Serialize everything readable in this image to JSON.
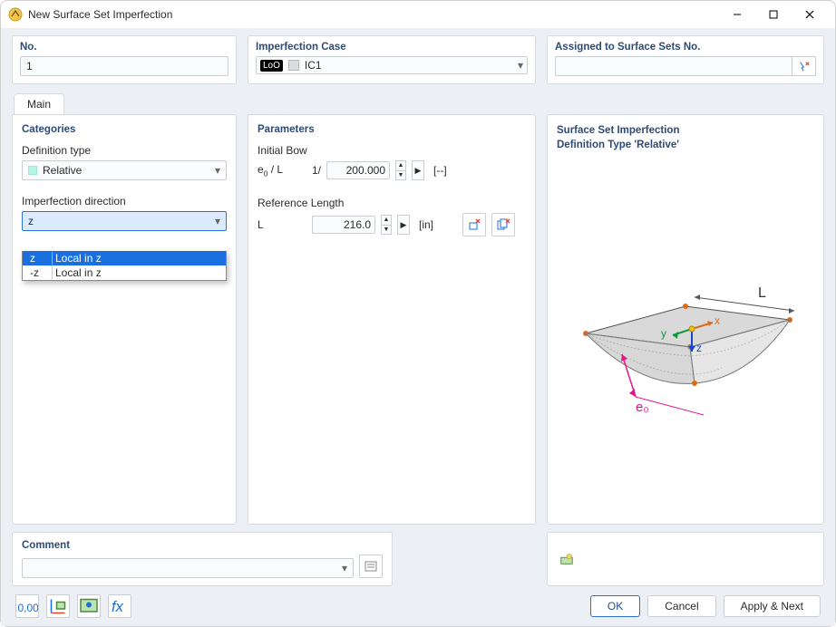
{
  "window": {
    "title": "New Surface Set Imperfection"
  },
  "header": {
    "no_label": "No.",
    "no_value": "1",
    "case_label": "Imperfection Case",
    "case_badge": "LoO",
    "case_name": "IC1",
    "assigned_label": "Assigned to Surface Sets No.",
    "assigned_value": ""
  },
  "tabs": {
    "main": "Main"
  },
  "categories": {
    "title": "Categories",
    "def_type_label": "Definition type",
    "def_type_value": "Relative",
    "dir_label": "Imperfection direction",
    "dir_value": "z",
    "dir_options": [
      {
        "short": "z",
        "long": "Local in z",
        "selected": true
      },
      {
        "short": "-z",
        "long": "Local in z",
        "selected": false
      }
    ]
  },
  "parameters": {
    "title": "Parameters",
    "initial_bow_label": "Initial Bow",
    "e0L_label": "e0 / L",
    "one_over": "1/",
    "e0L_value": "200.000",
    "e0L_unit": "[--]",
    "ref_len_label": "Reference Length",
    "L_label": "L",
    "L_value": "216.0",
    "L_unit": "[in]"
  },
  "diagram": {
    "title_l1": "Surface Set Imperfection",
    "title_l2": "Definition Type 'Relative'",
    "L": "L",
    "x": "x",
    "y": "y",
    "z": "z",
    "e0": "e₀"
  },
  "comment": {
    "label": "Comment",
    "value": ""
  },
  "footer": {
    "ok": "OK",
    "cancel": "Cancel",
    "apply_next": "Apply & Next"
  }
}
